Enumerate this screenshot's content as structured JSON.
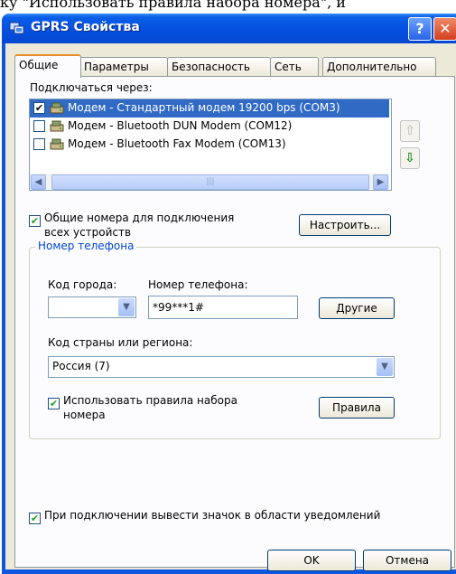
{
  "top_text": "ку \"Использовать правила набора номера\", и",
  "window": {
    "title": "GPRS Свойства",
    "help_glyph": "?",
    "close_glyph": "✕"
  },
  "tabs": [
    {
      "label": "Общие"
    },
    {
      "label": "Параметры"
    },
    {
      "label": "Безопасность"
    },
    {
      "label": "Сеть"
    },
    {
      "label": "Дополнительно"
    }
  ],
  "connect": {
    "label": "Подключаться через:",
    "items": [
      {
        "label": "Модем - Стандартный модем 19200 bps (COM3)",
        "checked": true,
        "selected": true
      },
      {
        "label": "Модем - Bluetooth DUN Modem (COM12)",
        "checked": false,
        "selected": false
      },
      {
        "label": "Модем - Bluetooth Fax Modem (COM13)",
        "checked": false,
        "selected": false
      }
    ],
    "scroll_left": "◀",
    "scroll_right": "▶",
    "scroll_grip": "|||",
    "move_up_glyph": "⇧",
    "move_down_glyph": "⇩"
  },
  "shared_numbers": {
    "label_line1": "Общие номера для подключения",
    "label_line2": "всех устройств",
    "checked": true
  },
  "configure_button": "Настроить...",
  "phone_group": {
    "title": "Номер телефона",
    "area_code_label": "Код города:",
    "area_code_value": "",
    "phone_label": "Номер телефона:",
    "phone_value": "*99***1#",
    "other_button": "Другие",
    "country_label": "Код страны или региона:",
    "country_value": "Россия (7)",
    "use_rules_line1": "Использовать правила набора",
    "use_rules_line2": "номера",
    "use_rules_checked": true,
    "rules_button": "Правила"
  },
  "tray_icon": {
    "label": "При подключении вывести значок в области уведомлений",
    "checked": true
  },
  "buttons": {
    "ok": "OK",
    "cancel": "Отмена"
  },
  "colors": {
    "title_bar": "#0550e0",
    "selection": "#316ac5",
    "group_title": "#0046d5",
    "check": "#21a121"
  }
}
